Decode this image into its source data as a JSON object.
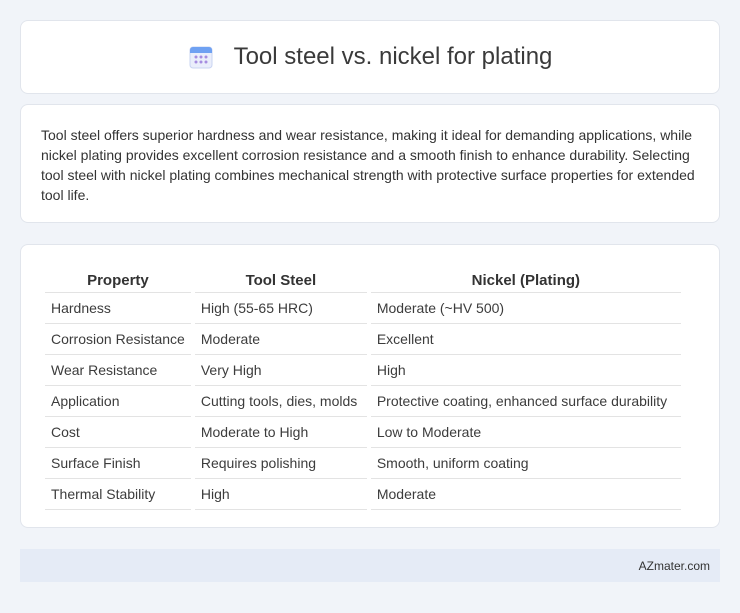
{
  "header": {
    "title": "Tool steel vs. nickel for plating",
    "icon": "calendar-icon",
    "icon_colors": {
      "top": "#6fa1f2",
      "body": "#eaeefb",
      "dots": "#a68de0"
    }
  },
  "description": "Tool steel offers superior hardness and wear resistance, making it ideal for demanding applications, while nickel plating provides excellent corrosion resistance and a smooth finish to enhance durability. Selecting tool steel with nickel plating combines mechanical strength with protective surface properties for extended tool life.",
  "table": {
    "headers": [
      "Property",
      "Tool Steel",
      "Nickel (Plating)"
    ],
    "rows": [
      [
        "Hardness",
        "High (55-65 HRC)",
        "Moderate (~HV 500)"
      ],
      [
        "Corrosion Resistance",
        "Moderate",
        "Excellent"
      ],
      [
        "Wear Resistance",
        "Very High",
        "High"
      ],
      [
        "Application",
        "Cutting tools, dies, molds",
        "Protective coating, enhanced surface durability"
      ],
      [
        "Cost",
        "Moderate to High",
        "Low to Moderate"
      ],
      [
        "Surface Finish",
        "Requires polishing",
        "Smooth, uniform coating"
      ],
      [
        "Thermal Stability",
        "High",
        "Moderate"
      ]
    ]
  },
  "footer": {
    "text": "AZmater.com"
  },
  "colors": {
    "background": "#f1f4f9",
    "footer_bg": "#e5ebf6",
    "border": "#e1e5ec"
  }
}
